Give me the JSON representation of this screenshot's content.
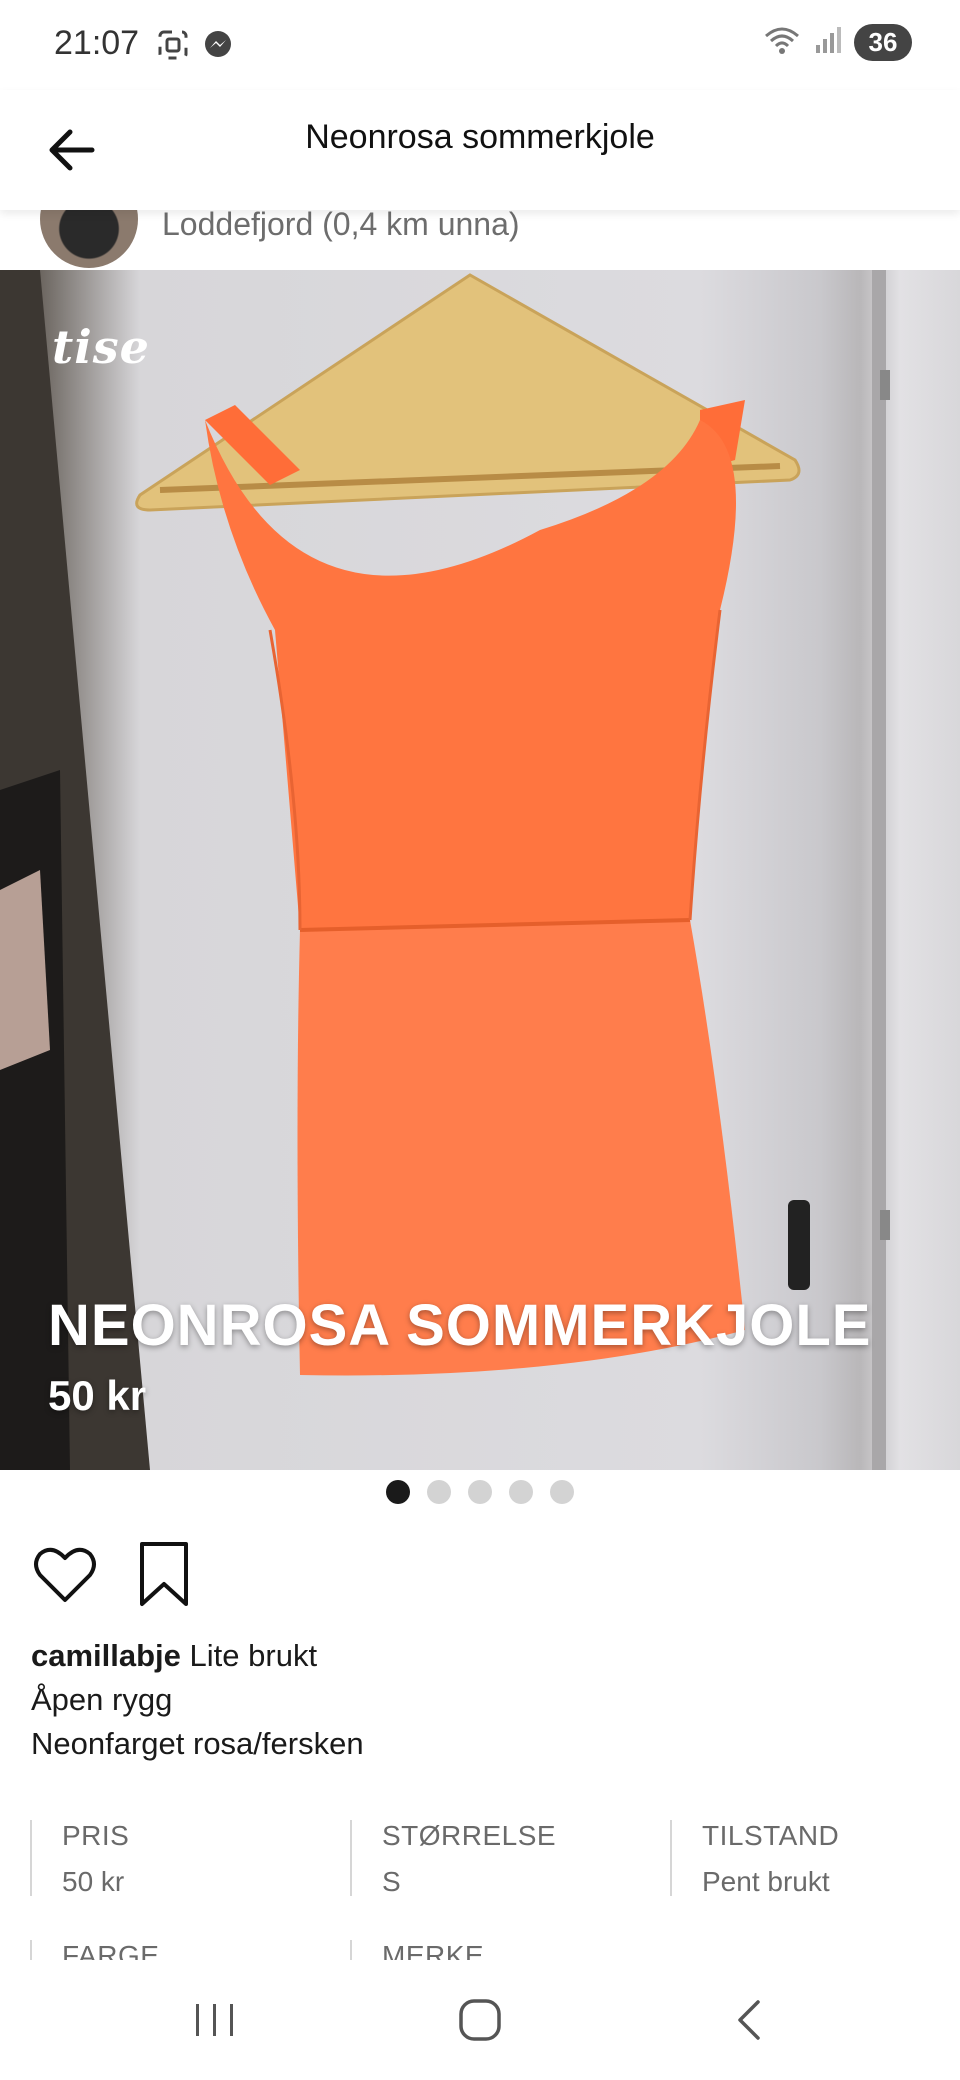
{
  "status_bar": {
    "time": "21:07",
    "battery": "36",
    "icons": [
      "screenshot-icon",
      "messenger-icon",
      "wifi-icon",
      "signal-icon"
    ]
  },
  "header": {
    "title": "Neonrosa sommerkjole"
  },
  "seller": {
    "location": "Loddefjord (0,4 km unna)"
  },
  "photo": {
    "logo": "tise",
    "title": "NEONROSA SOMMERKJOLE",
    "price": "50 kr",
    "page_count": 5,
    "active_page": 1
  },
  "description": {
    "username": "camillabje",
    "line1": "Lite brukt",
    "line2": "Åpen rygg",
    "line3": "Neonfarget rosa/fersken"
  },
  "specs": [
    {
      "label": "PRIS",
      "value": "50 kr"
    },
    {
      "label": "STØRRELSE",
      "value": "S"
    },
    {
      "label": "TILSTAND",
      "value": "Pent brukt"
    },
    {
      "label": "FARGE",
      "value": ""
    },
    {
      "label": "MERKE",
      "value": ""
    }
  ],
  "colors": {
    "dress": "#ff7a45",
    "hanger": "#e3c27c",
    "text": "#111111",
    "muted": "#6a6a6a"
  }
}
